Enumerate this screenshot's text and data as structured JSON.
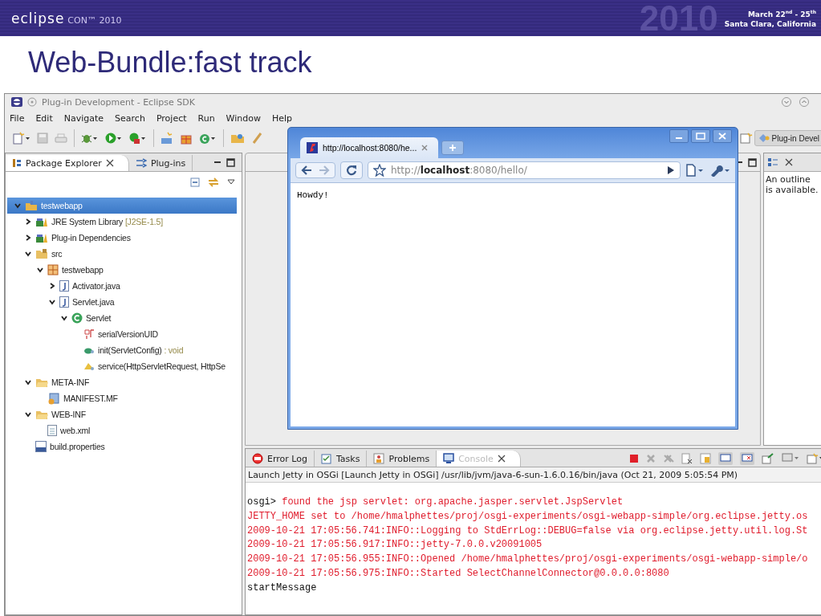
{
  "slide": {
    "logo": "eclipse",
    "logo_suffix": "CON™ 2010",
    "event_dates": "March 22$^{nd}$ - 25$^{th}$",
    "event_place": "Santa Clara, California",
    "year_mark": "2010",
    "title": "Web-Bundle:fast track"
  },
  "ide": {
    "title": "Plug-in Development - Eclipse SDK",
    "menu": [
      "File",
      "Edit",
      "Navigate",
      "Search",
      "Project",
      "Run",
      "Window",
      "Help"
    ],
    "perspective": "Plug-in Devel",
    "left_tabs": [
      {
        "label": "Package Explorer",
        "selected": true
      },
      {
        "label": "Plug-ins",
        "selected": false
      }
    ],
    "tree": [
      {
        "label": "testwebapp",
        "kind": "project",
        "expanded": true,
        "selected": true,
        "children": [
          {
            "label": "JRE System Library",
            "decoration": "[J2SE-1.5]",
            "kind": "library",
            "expanded": false,
            "selected": false
          },
          {
            "label": "Plug-in Dependencies",
            "kind": "library",
            "expanded": false,
            "selected": false
          },
          {
            "label": "src",
            "kind": "source-folder",
            "expanded": true,
            "selected": false,
            "children": [
              {
                "label": "testwebapp",
                "kind": "package",
                "expanded": true,
                "selected": false,
                "children": [
                  {
                    "label": "Activator.java",
                    "kind": "java-file",
                    "expanded": false,
                    "selected": false
                  },
                  {
                    "label": "Servlet.java",
                    "kind": "java-file",
                    "expanded": true,
                    "selected": false,
                    "children": [
                      {
                        "label": "Servlet",
                        "kind": "class",
                        "expanded": true,
                        "selected": false,
                        "children": [
                          {
                            "label": "serialVersionUID",
                            "kind": "field",
                            "selected": false
                          },
                          {
                            "label": "init(ServletConfig)",
                            "decoration": ": void",
                            "kind": "method-public",
                            "selected": false
                          },
                          {
                            "label": "service(HttpServletRequest, HttpSe",
                            "kind": "method-protected",
                            "selected": false
                          }
                        ]
                      }
                    ]
                  }
                ]
              }
            ]
          },
          {
            "label": "META-INF",
            "kind": "folder",
            "expanded": true,
            "selected": false,
            "children": [
              {
                "label": "MANIFEST.MF",
                "kind": "manifest",
                "selected": false
              }
            ]
          },
          {
            "label": "WEB-INF",
            "kind": "folder",
            "expanded": true,
            "selected": false,
            "children": [
              {
                "label": "web.xml",
                "kind": "xml-file",
                "selected": false
              }
            ]
          },
          {
            "label": "build.properties",
            "kind": "properties-file",
            "selected": false
          }
        ]
      }
    ],
    "outline_message": "An outline is available.",
    "bottom_tabs": [
      {
        "label": "Error Log",
        "kind": "error-log",
        "selected": false
      },
      {
        "label": "Tasks",
        "kind": "tasks",
        "selected": false
      },
      {
        "label": "Problems",
        "kind": "problems",
        "selected": false
      },
      {
        "label": "Console",
        "kind": "console",
        "selected": true
      }
    ],
    "launch": "Launch Jetty in OSGi [Launch Jetty in OSGi] /usr/lib/jvm/java-6-sun-1.6.0.16/bin/java (Oct 21, 2009 5:05:54 PM)",
    "console_lines": [
      {
        "prompt": "osgi> ",
        "text": "found the jsp servlet: org.apache.jasper.servlet.JspServlet",
        "kind": "stderr"
      },
      {
        "text": "JETTY_HOME set to /home/hmalphettes/proj/osgi-experiments/osgi-webapp-simple/org.eclipse.jetty.os",
        "kind": "stderr"
      },
      {
        "text": "2009-10-21 17:05:56.741:INFO::Logging to StdErrLog::DEBUG=false via org.eclipse.jetty.util.log.St",
        "kind": "stderr"
      },
      {
        "text": "2009-10-21 17:05:56.917:INFO::jetty-7.0.0.v20091005",
        "kind": "stderr"
      },
      {
        "text": "2009-10-21 17:05:56.955:INFO::Opened /home/hmalphettes/proj/osgi-experiments/osgi-webapp-simple/o",
        "kind": "stderr"
      },
      {
        "text": "2009-10-21 17:05:56.975:INFO::Started SelectChannelConnector@0.0.0.0:8080",
        "kind": "stderr"
      },
      {
        "text": "startMessage",
        "kind": "stdout"
      }
    ]
  },
  "browser": {
    "tab_title": "http://localhost:8080/he...",
    "url": "http://**localhost**:8080/hello/",
    "content": "Howdy!"
  }
}
